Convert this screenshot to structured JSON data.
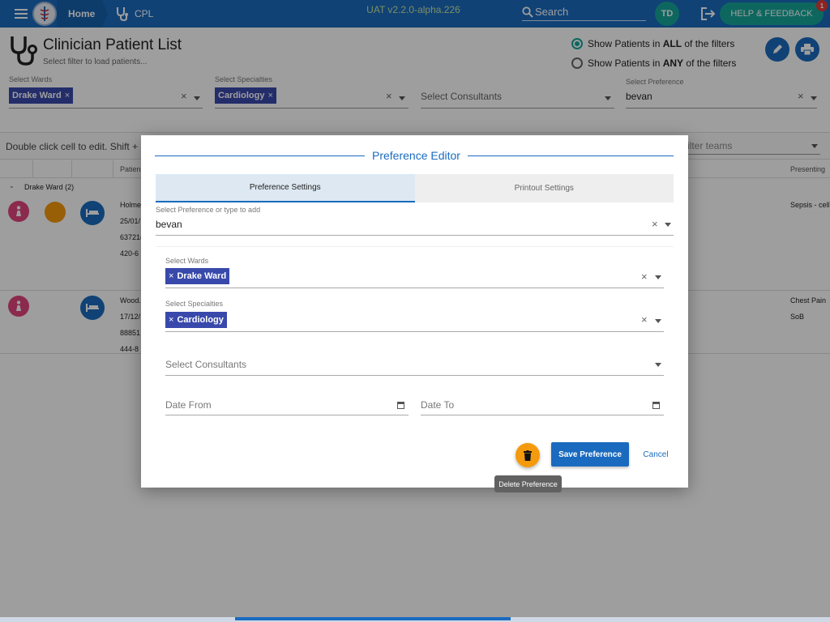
{
  "app": {
    "breadcrumb_home": "Home",
    "breadcrumb_cpl": "CPL",
    "version": "UAT v2.2.0-alpha.226",
    "search_label": "Search",
    "user_initials": "TD",
    "help_label": "HELP & FEEDBACK",
    "notification_count": "1"
  },
  "page": {
    "title": "Clinician Patient List",
    "subtitle": "Select filter to load patients...",
    "filters": {
      "wards_label": "Select Wards",
      "wards_chip": "Drake Ward",
      "specialties_label": "Select Specialties",
      "specialties_chip": "Cardiology",
      "consultants_placeholder": "Select Consultants",
      "preference_label": "Select Preference",
      "preference_value": "bevan"
    },
    "radio_all": {
      "pre": "Show Patients in ",
      "bold": "ALL",
      "post": " of the filters"
    },
    "radio_any": {
      "pre": "Show Patients in ",
      "bold": "ANY",
      "post": " of the filters"
    },
    "hint": "Double click cell to edit. Shift +",
    "filter_teams_placeholder": "ilter teams",
    "columns": {
      "patient": "Patien",
      "presenting": "Presenting"
    },
    "group_label": "Drake Ward (2)",
    "rows": [
      {
        "name": "Holme",
        "dob": "25/01/",
        "nhs": "63721(",
        "phone": "420-6",
        "presenting": "Sepsis - cell",
        "presenting2": ""
      },
      {
        "name": "Wood.",
        "dob": "17/12/",
        "nhs": "88851",
        "phone": "444-8",
        "presenting": "Chest Pain",
        "presenting2": "SoB"
      }
    ]
  },
  "dialog": {
    "title": "Preference Editor",
    "tabs": [
      "Preference Settings",
      "Printout Settings"
    ],
    "preference_label": "Select Preference or type to add",
    "preference_value": "bevan",
    "wards_label": "Select Wards",
    "wards_chip": "Drake Ward",
    "specialties_label": "Select Specialties",
    "specialties_chip": "Cardiology",
    "consultants_placeholder": "Select Consultants",
    "date_from_placeholder": "Date From",
    "date_to_placeholder": "Date To",
    "save_label": "Save Preference",
    "cancel_label": "Cancel",
    "delete_tooltip": "Delete Preference"
  },
  "colors": {
    "primary": "#1a6bbf",
    "teal": "#16a79a",
    "chip": "#3949ab",
    "delete": "#f59a0c",
    "female_icon": "#e0457b"
  }
}
